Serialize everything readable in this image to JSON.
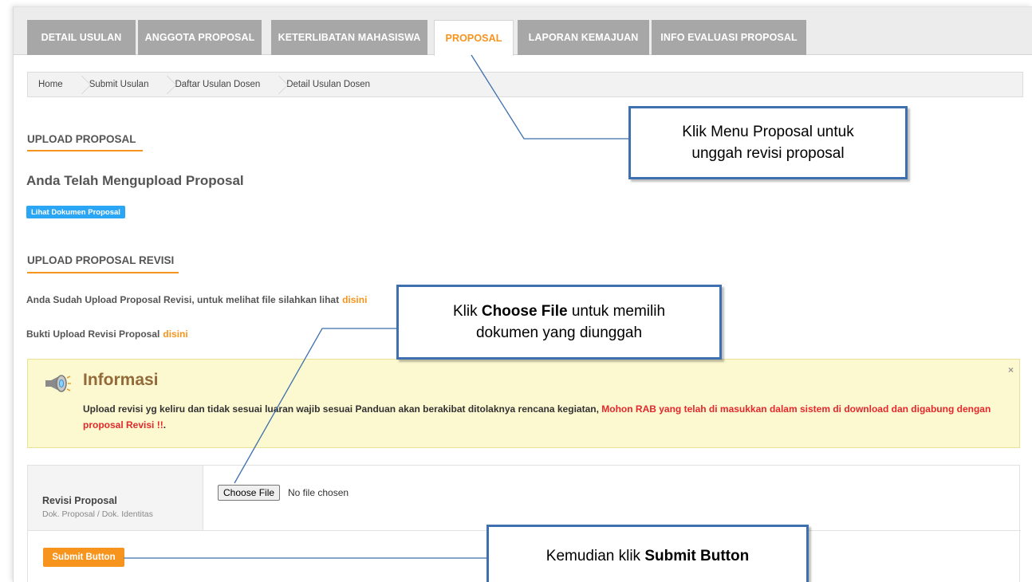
{
  "tabs": [
    {
      "label": "DETAIL USULAN",
      "active": false
    },
    {
      "label": "ANGGOTA PROPOSAL",
      "active": false
    },
    {
      "label": "KETERLIBATAN MAHASISWA",
      "active": false
    },
    {
      "label": "PROPOSAL",
      "active": true
    },
    {
      "label": "LAPORAN KEMAJUAN",
      "active": false
    },
    {
      "label": "INFO EVALUASI PROPOSAL",
      "active": false
    }
  ],
  "breadcrumb": [
    "Home",
    "Submit Usulan",
    "Daftar Usulan Dosen",
    "Detail Usulan Dosen"
  ],
  "upload_proposal": {
    "title": "UPLOAD PROPOSAL",
    "status": "Anda Telah Mengupload Proposal",
    "view_button": "Lihat Dokumen Proposal"
  },
  "upload_revisi": {
    "title": "UPLOAD PROPOSAL REVISI",
    "uploaded_text": "Anda Sudah Upload Proposal Revisi, untuk melihat file silahkan lihat",
    "uploaded_link": "disini",
    "proof_text": "Bukti Upload Revisi Proposal",
    "proof_link": "disini"
  },
  "alert": {
    "title": "Informasi",
    "close": "×",
    "body_normal": "Upload revisi yg keliru dan tidak sesuai luaran wajib sesuai Panduan akan berakibat ditolaknya rencana kegiatan,",
    "body_red": "Mohon RAB yang telah di masukkan dalam sistem di download dan digabung dengan proposal Revisi !!",
    "body_end": "."
  },
  "form": {
    "field_label": "Revisi Proposal",
    "field_sublabel": "Dok. Proposal / Dok. Identitas",
    "choose_file": "Choose File",
    "no_file": "No file chosen",
    "submit": "Submit Button"
  },
  "callouts": {
    "menu": {
      "line1": "Klik Menu Proposal untuk",
      "line2": "unggah revisi proposal"
    },
    "choose": {
      "pre": "Klik ",
      "bold": "Choose File",
      "post": " untuk memilih",
      "line2": "dokumen yang diunggah"
    },
    "submit": {
      "pre": "Kemudian klik ",
      "bold": "Submit Button"
    }
  },
  "colors": {
    "accent": "#f7941d",
    "tab_inactive": "#a7a7a7",
    "callout_border": "#3e6fae",
    "alert_bg": "#fcf8cf",
    "link_blue": "#2ba6f4",
    "red_text": "#e3282e"
  }
}
